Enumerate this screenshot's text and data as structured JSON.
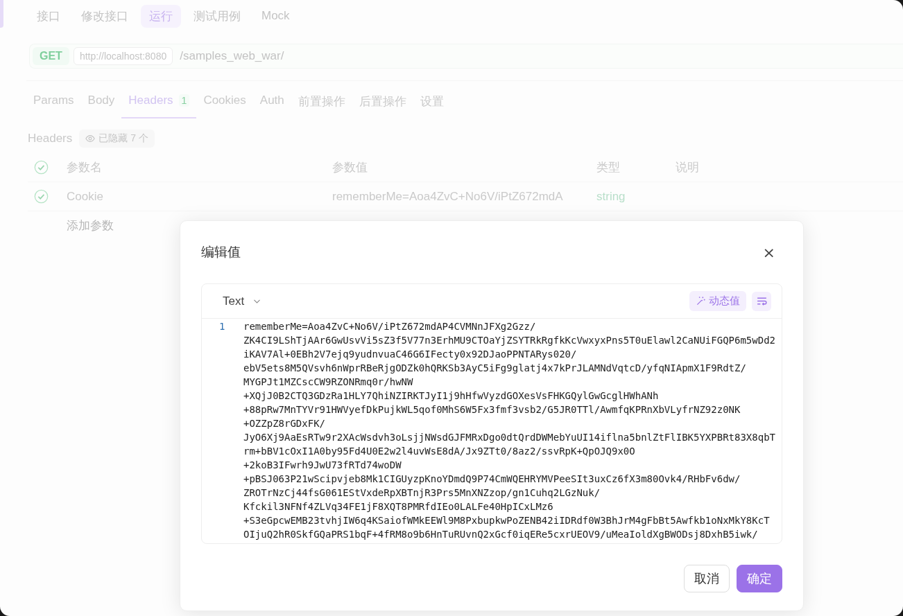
{
  "top_tabs": [
    {
      "label": "接口",
      "selected": false
    },
    {
      "label": "修改接口",
      "selected": false
    },
    {
      "label": "运行",
      "selected": true
    },
    {
      "label": "测试用例",
      "selected": false
    },
    {
      "label": "Mock",
      "selected": false
    }
  ],
  "request": {
    "method": "GET",
    "host": "http://localhost:8080",
    "path": "/samples_web_war/"
  },
  "param_tabs": [
    {
      "label": "Params",
      "selected": false
    },
    {
      "label": "Body",
      "selected": false
    },
    {
      "label": "Headers",
      "count": "1",
      "selected": true
    },
    {
      "label": "Cookies",
      "selected": false
    },
    {
      "label": "Auth",
      "selected": false
    },
    {
      "label": "前置操作",
      "selected": false
    },
    {
      "label": "后置操作",
      "selected": false
    },
    {
      "label": "设置",
      "selected": false
    }
  ],
  "headers": {
    "title": "Headers",
    "hidden_badge": "已隐藏 7 个",
    "columns": [
      {
        "label": "参数名"
      },
      {
        "label": "参数值"
      },
      {
        "label": "类型"
      },
      {
        "label": "说明"
      }
    ],
    "header_checked": true,
    "rows": [
      {
        "checked": true,
        "name": "Cookie",
        "value": "rememberMe=Aoa4ZvC+No6V/iPtZ672mdA",
        "type": "string"
      }
    ],
    "add_placeholder": "添加参数"
  },
  "dialog": {
    "title": "编辑值",
    "close": "×",
    "format": "Text",
    "dynamic_button": "动态值",
    "line_number": "1",
    "value_lines": [
      "rememberMe=Aoa4ZvC+No6V/iPtZ672mdAP4CVMNnJFXg2Gzz/",
      "ZK4CI9LShTjAAr6GwUsvVi5sZ3f5V77n3ErhMU9CTOaYjZSYTRkRgfkKcVwxyxPns5T0uElawl2CaNUiFGQP6m5wDd2",
      "iKAV7Al+0EBh2V7ejq9yudnvuaC46G6IFecty0x92DJaoPPNTARys020/",
      "ebV5ets8M5QVsvh6nWprRBeRjgODZk0hQRKSb3AyC5iFg9glatj4x7kPrJLAMNdVqtcD/yfqNIApmX1F9RdtZ/",
      "MYGPJt1MZCscCW9RZONRmq0r/hwNW",
      "+XQjJ0B2CTQ3GDzRa1HLY7QhiNZIRKTJyI1j9hHfwVyzdGOXesVsFHKGQylGwGcglHWhANh",
      "+88pRw7MnTYVr91HWVyefDkPujkWL5qof0MhS6W5Fx3fmf3vsb2/G5JR0TTl/AwmfqKPRnXbVLyfrNZ92z0NK",
      "+OZZpZ8rGDxFK/",
      "JyO6Xj9AaEsRTw9r2XAcWsdvh3oLsjjNWsdGJFMRxDgo0dtQrdDWMebYuUI14iflna5bnlZtFlIBK5YXPBRt83X8qbT",
      "rm+bBV1cOxI1A0by95Fd4U0E2w2l4uvWsE8dA/Jx9ZTt0/8az2/ssvRpK+QpOJQ9x0O",
      "+2koB3IFwrh9JwU73fRTd74woDW",
      "+pBSJ063P21wScipvjeb8Mk1CIGUyzpKnoYDmdQ9P74CmWQEHRYMVPeeSIt3uxCz6fX3m80Ovk4/RHbFv6dw/",
      "ZROTrNzCj44fsG061EStVxdeRpXBTnjR3Prs5MnXNZzop/gn1Cuhq2LGzNuk/",
      "Kfckil3NFNf4ZLVq34FE1jF8XQT8PMRfdIEo0LALFe40HpICxLMz6",
      "+S3eGpcwEMB23tvhjIW6q4KSaiofWMkEEWl9M8PxbupkwPoZENB42iIDRdf0W3BhJrM4gFbBt5Awfkb1oNxMkY8KcT",
      "OIjuQ2hR0SkfGQaPRS1bqF+4fRM8o9b6HnTuRUvnQ2xGcf0iqERe5cxrUEOV9/uMeaIoldXgBWODsj8DxhB5iwk/"
    ],
    "buttons": [
      {
        "label": "取消",
        "kind": "secondary"
      },
      {
        "label": "确定",
        "kind": "primary"
      }
    ]
  }
}
